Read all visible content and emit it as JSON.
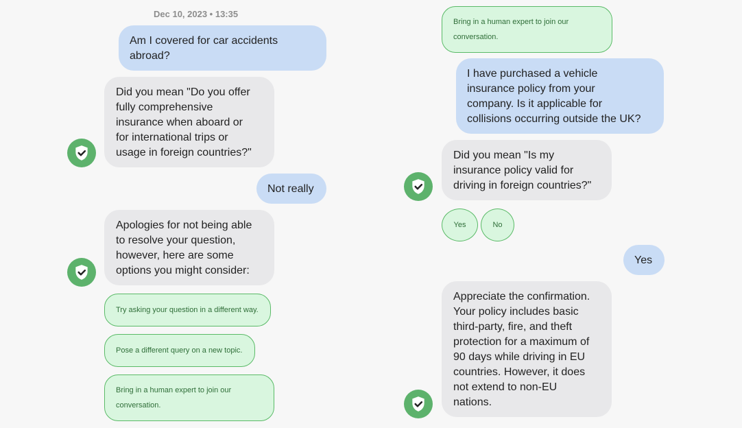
{
  "left": {
    "timestamp": "Dec 10, 2023 • 13:35",
    "msg1_user": "Am I covered for car accidents\nabroad?",
    "msg2_bot": "Did you mean \"Do you offer\nfully comprehensive\ninsurance when aboard or\nfor international trips or\nusage in foreign countries?\"",
    "msg3_user": "Not really",
    "msg4_bot": "Apologies for not being able\nto resolve your question,\nhowever, here are some\noptions you might consider:",
    "options": [
      "Try asking your question in a different way.",
      "Pose a different query on a new topic.",
      "Bring in a human expert to join our\nconversation."
    ]
  },
  "right": {
    "chip_top": "Bring in a human expert to join our\nconversation.",
    "msg1_user": "I have purchased a vehicle\ninsurance policy from your\ncompany. Is it applicable for\ncollisions occurring outside the UK?",
    "msg2_bot": "Did you mean \"Is my\ninsurance policy valid for\ndriving in foreign countries?\"",
    "yes_chip": "Yes",
    "no_chip": "No",
    "msg3_user": "Yes",
    "msg4_bot": "Appreciate the confirmation.\nYour policy includes basic\nthird-party, fire, and theft\nprotection for a maximum of\n90 days while driving in EU\ncountries. However, it does\nnot extend to non-EU\nnations."
  },
  "colors": {
    "user_bubble": "#c9dcf5",
    "bot_bubble": "#e8e8ea",
    "chip_bg": "#d9f6df",
    "chip_border": "#5aba67",
    "avatar": "#5db26c"
  },
  "icons": {
    "bot_avatar": "shield-check-icon"
  }
}
